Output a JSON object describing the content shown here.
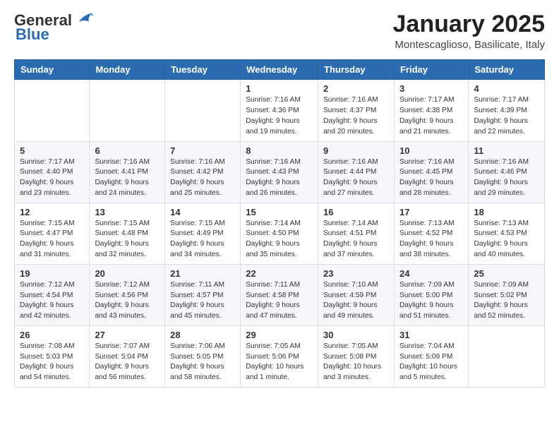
{
  "header": {
    "logo_general": "General",
    "logo_blue": "Blue",
    "month_title": "January 2025",
    "location": "Montescaglioso, Basilicate, Italy"
  },
  "calendar": {
    "days_of_week": [
      "Sunday",
      "Monday",
      "Tuesday",
      "Wednesday",
      "Thursday",
      "Friday",
      "Saturday"
    ],
    "weeks": [
      [
        {
          "day": "",
          "info": ""
        },
        {
          "day": "",
          "info": ""
        },
        {
          "day": "",
          "info": ""
        },
        {
          "day": "1",
          "info": "Sunrise: 7:16 AM\nSunset: 4:36 PM\nDaylight: 9 hours\nand 19 minutes."
        },
        {
          "day": "2",
          "info": "Sunrise: 7:16 AM\nSunset: 4:37 PM\nDaylight: 9 hours\nand 20 minutes."
        },
        {
          "day": "3",
          "info": "Sunrise: 7:17 AM\nSunset: 4:38 PM\nDaylight: 9 hours\nand 21 minutes."
        },
        {
          "day": "4",
          "info": "Sunrise: 7:17 AM\nSunset: 4:39 PM\nDaylight: 9 hours\nand 22 minutes."
        }
      ],
      [
        {
          "day": "5",
          "info": "Sunrise: 7:17 AM\nSunset: 4:40 PM\nDaylight: 9 hours\nand 23 minutes."
        },
        {
          "day": "6",
          "info": "Sunrise: 7:16 AM\nSunset: 4:41 PM\nDaylight: 9 hours\nand 24 minutes."
        },
        {
          "day": "7",
          "info": "Sunrise: 7:16 AM\nSunset: 4:42 PM\nDaylight: 9 hours\nand 25 minutes."
        },
        {
          "day": "8",
          "info": "Sunrise: 7:16 AM\nSunset: 4:43 PM\nDaylight: 9 hours\nand 26 minutes."
        },
        {
          "day": "9",
          "info": "Sunrise: 7:16 AM\nSunset: 4:44 PM\nDaylight: 9 hours\nand 27 minutes."
        },
        {
          "day": "10",
          "info": "Sunrise: 7:16 AM\nSunset: 4:45 PM\nDaylight: 9 hours\nand 28 minutes."
        },
        {
          "day": "11",
          "info": "Sunrise: 7:16 AM\nSunset: 4:46 PM\nDaylight: 9 hours\nand 29 minutes."
        }
      ],
      [
        {
          "day": "12",
          "info": "Sunrise: 7:15 AM\nSunset: 4:47 PM\nDaylight: 9 hours\nand 31 minutes."
        },
        {
          "day": "13",
          "info": "Sunrise: 7:15 AM\nSunset: 4:48 PM\nDaylight: 9 hours\nand 32 minutes."
        },
        {
          "day": "14",
          "info": "Sunrise: 7:15 AM\nSunset: 4:49 PM\nDaylight: 9 hours\nand 34 minutes."
        },
        {
          "day": "15",
          "info": "Sunrise: 7:14 AM\nSunset: 4:50 PM\nDaylight: 9 hours\nand 35 minutes."
        },
        {
          "day": "16",
          "info": "Sunrise: 7:14 AM\nSunset: 4:51 PM\nDaylight: 9 hours\nand 37 minutes."
        },
        {
          "day": "17",
          "info": "Sunrise: 7:13 AM\nSunset: 4:52 PM\nDaylight: 9 hours\nand 38 minutes."
        },
        {
          "day": "18",
          "info": "Sunrise: 7:13 AM\nSunset: 4:53 PM\nDaylight: 9 hours\nand 40 minutes."
        }
      ],
      [
        {
          "day": "19",
          "info": "Sunrise: 7:12 AM\nSunset: 4:54 PM\nDaylight: 9 hours\nand 42 minutes."
        },
        {
          "day": "20",
          "info": "Sunrise: 7:12 AM\nSunset: 4:56 PM\nDaylight: 9 hours\nand 43 minutes."
        },
        {
          "day": "21",
          "info": "Sunrise: 7:11 AM\nSunset: 4:57 PM\nDaylight: 9 hours\nand 45 minutes."
        },
        {
          "day": "22",
          "info": "Sunrise: 7:11 AM\nSunset: 4:58 PM\nDaylight: 9 hours\nand 47 minutes."
        },
        {
          "day": "23",
          "info": "Sunrise: 7:10 AM\nSunset: 4:59 PM\nDaylight: 9 hours\nand 49 minutes."
        },
        {
          "day": "24",
          "info": "Sunrise: 7:09 AM\nSunset: 5:00 PM\nDaylight: 9 hours\nand 51 minutes."
        },
        {
          "day": "25",
          "info": "Sunrise: 7:09 AM\nSunset: 5:02 PM\nDaylight: 9 hours\nand 52 minutes."
        }
      ],
      [
        {
          "day": "26",
          "info": "Sunrise: 7:08 AM\nSunset: 5:03 PM\nDaylight: 9 hours\nand 54 minutes."
        },
        {
          "day": "27",
          "info": "Sunrise: 7:07 AM\nSunset: 5:04 PM\nDaylight: 9 hours\nand 56 minutes."
        },
        {
          "day": "28",
          "info": "Sunrise: 7:06 AM\nSunset: 5:05 PM\nDaylight: 9 hours\nand 58 minutes."
        },
        {
          "day": "29",
          "info": "Sunrise: 7:05 AM\nSunset: 5:06 PM\nDaylight: 10 hours\nand 1 minute."
        },
        {
          "day": "30",
          "info": "Sunrise: 7:05 AM\nSunset: 5:08 PM\nDaylight: 10 hours\nand 3 minutes."
        },
        {
          "day": "31",
          "info": "Sunrise: 7:04 AM\nSunset: 5:09 PM\nDaylight: 10 hours\nand 5 minutes."
        },
        {
          "day": "",
          "info": ""
        }
      ]
    ]
  }
}
